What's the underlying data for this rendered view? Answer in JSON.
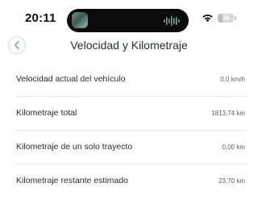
{
  "status_bar": {
    "time": "20:11",
    "battery_level": "36",
    "battery_fraction": 0.36
  },
  "header": {
    "title": "Velocidad y Kilometraje"
  },
  "rows": [
    {
      "label": "Velocidad actual del vehículo",
      "value": "0,0 km/h"
    },
    {
      "label": "Kilometraje total",
      "value": "1813,74 km"
    },
    {
      "label": "Kilometraje de un solo trayecto",
      "value": "0,00 km"
    },
    {
      "label": "Kilometraje restante estimado",
      "value": "23,70 km"
    }
  ],
  "icons": {
    "back": "chevron-left-icon",
    "wifi": "wifi-icon",
    "battery": "battery-icon",
    "audio": "audio-waveform-icon"
  }
}
